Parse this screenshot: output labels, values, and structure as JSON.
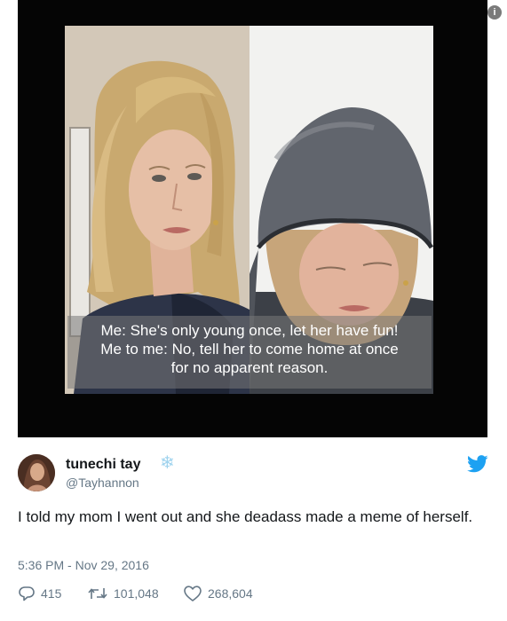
{
  "media": {
    "caption_lines": [
      "Me: She's only young once, let her have fun!",
      "Me to me: No, tell her to come home at once",
      "for no apparent reason."
    ],
    "info_icon": "info-icon"
  },
  "tweet": {
    "display_name": "tunechi tay",
    "handle": "@Tayhannon",
    "name_emoji_icon": "snowflake-icon",
    "brand_icon": "twitter-bird-icon",
    "text": "I told my mom I went out and she deadass made a meme of herself.",
    "timestamp": "5:36 PM - Nov 29, 2016",
    "stats": {
      "replies": "415",
      "retweets": "101,048",
      "likes": "268,604"
    },
    "colors": {
      "brand_blue": "#1da1f2",
      "meta_gray": "#657786"
    }
  }
}
